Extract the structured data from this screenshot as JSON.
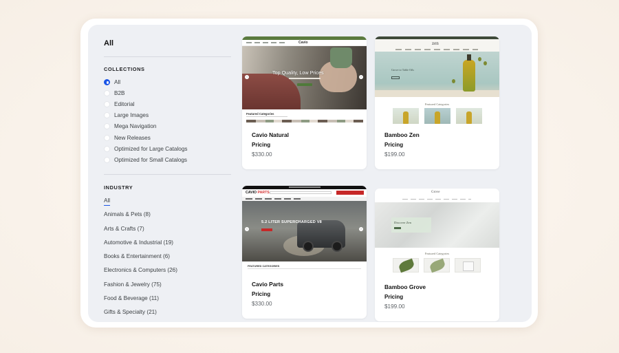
{
  "sidebar": {
    "heading": "All",
    "collections": {
      "title": "COLLECTIONS",
      "items": [
        {
          "label": "All",
          "checked": true
        },
        {
          "label": "B2B",
          "checked": false
        },
        {
          "label": "Editorial",
          "checked": false
        },
        {
          "label": "Large Images",
          "checked": false
        },
        {
          "label": "Mega Navigation",
          "checked": false
        },
        {
          "label": "New Releases",
          "checked": false
        },
        {
          "label": "Optimized for Large Catalogs",
          "checked": false
        },
        {
          "label": "Optimized for Small Catalogs",
          "checked": false
        }
      ]
    },
    "industry": {
      "title": "INDUSTRY",
      "items": [
        {
          "label": "All",
          "active": true
        },
        {
          "label": "Animals & Pets (8)"
        },
        {
          "label": "Arts & Crafts (7)"
        },
        {
          "label": "Automotive & Industrial (19)"
        },
        {
          "label": "Books & Entertainment (6)"
        },
        {
          "label": "Electronics & Computers (26)"
        },
        {
          "label": "Fashion & Jewelry (75)"
        },
        {
          "label": "Food & Beverage (11)"
        },
        {
          "label": "Gifts & Specialty (21)"
        }
      ]
    }
  },
  "themes": [
    {
      "name": "Cavio Natural",
      "pricing_label": "Pricing",
      "price": "$330.00",
      "preview": {
        "hero_title": "Top Quality, Low Prices",
        "logo": "Cavio",
        "featured": "Featured Categories"
      }
    },
    {
      "name": "Bamboo Zen",
      "pricing_label": "Pricing",
      "price": "$199.00",
      "preview": {
        "hero_title": "Grove to Table Oils",
        "logo": "zen",
        "featured": "Featured Categories"
      }
    },
    {
      "name": "Cavio Parts",
      "pricing_label": "Pricing",
      "price": "$330.00",
      "preview": {
        "hero_title": "5.2 LITER SUPERCHARGED V8",
        "logo_main": "CAVIO",
        "logo_accent": "PARTS",
        "featured": "FEATURED CATEGORIES"
      }
    },
    {
      "name": "Bamboo Grove",
      "pricing_label": "Pricing",
      "price": "$199.00",
      "preview": {
        "hero_title": "Discover Zen",
        "logo": "Grove",
        "featured": "Featured Categories"
      }
    }
  ],
  "colors": {
    "accent": "#1a55e6",
    "panel": "#eef0f4",
    "page_background": "#faf6f1"
  }
}
